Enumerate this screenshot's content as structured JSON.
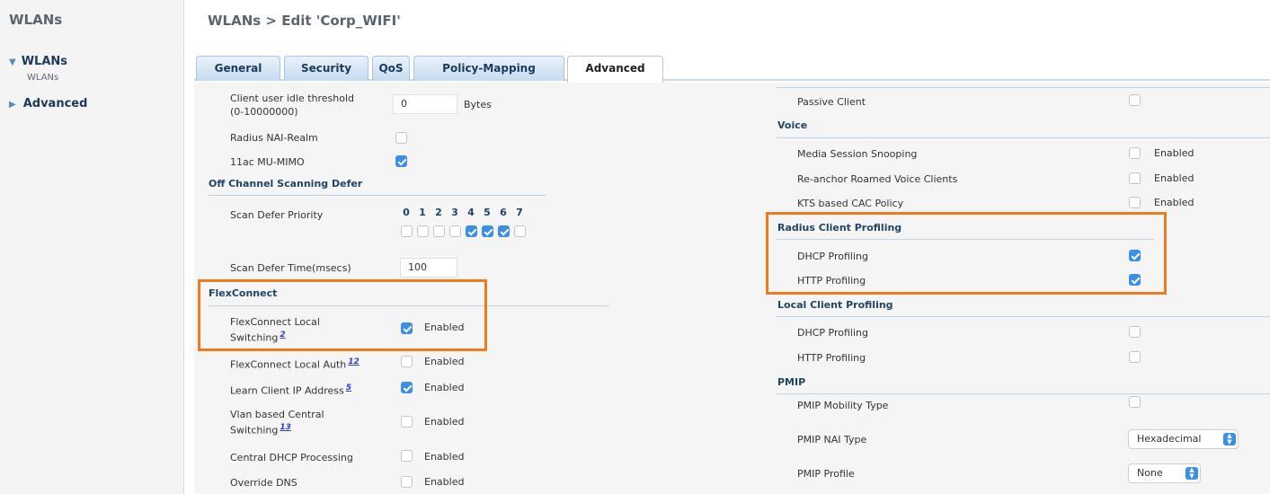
{
  "sidebar": {
    "title": "WLANs",
    "wlans_label": "WLANs",
    "wlans_sub": "WLANs",
    "advanced_label": "Advanced"
  },
  "header": {
    "title": "WLANs > Edit  'Corp_WIFI'"
  },
  "tabs": [
    "General",
    "Security",
    "QoS",
    "Policy-Mapping",
    "Advanced"
  ],
  "left": {
    "idle_threshold_label_1": "Client user idle threshold",
    "idle_threshold_label_2": "(0-10000000)",
    "idle_threshold_value": "0",
    "idle_threshold_unit": "Bytes",
    "radius_nai_label": "Radius NAI-Realm",
    "mu_mimo_label": "11ac MU-MIMO",
    "off_channel_section": "Off Channel Scanning Defer",
    "scan_defer_priority_label": "Scan Defer Priority",
    "priority_numbers": [
      "0",
      "1",
      "2",
      "3",
      "4",
      "5",
      "6",
      "7"
    ],
    "scan_defer_time_label": "Scan Defer Time(msecs)",
    "scan_defer_time_value": "100",
    "flexconnect_section": "FlexConnect",
    "fc_local_switching_1": "FlexConnect Local",
    "fc_local_switching_2": "Switching",
    "fc_local_switching_ref": "2",
    "fc_local_auth": "FlexConnect Local Auth",
    "fc_local_auth_ref": "12",
    "learn_ip": "Learn Client IP Address",
    "learn_ip_ref": "5",
    "vlan_central_1": "Vlan based Central",
    "vlan_central_2": "Switching",
    "vlan_central_ref": "13",
    "central_dhcp": "Central DHCP Processing",
    "override_dns": "Override DNS",
    "enabled": "Enabled"
  },
  "right": {
    "passive_client": "Passive Client",
    "voice_section": "Voice",
    "media_session": "Media Session Snooping",
    "reanchor": "Re-anchor Roamed Voice Clients",
    "kts_cac": "KTS based CAC Policy",
    "radius_profiling_section": "Radius Client Profiling",
    "radius_dhcp": "DHCP Profiling",
    "radius_http": "HTTP Profiling",
    "local_profiling_section": "Local Client Profiling",
    "local_dhcp": "DHCP Profiling",
    "local_http": "HTTP Profiling",
    "pmip_section": "PMIP",
    "pmip_mobility": "PMIP Mobility Type",
    "pmip_nai": "PMIP NAI Type",
    "pmip_nai_value": "Hexadecimal",
    "pmip_profile": "PMIP Profile",
    "pmip_profile_value": "None",
    "enabled": "Enabled"
  },
  "colors": {
    "highlight": "#f07a1e",
    "checkbox_on": "#3b8fe5",
    "section_text": "#1f4466"
  }
}
